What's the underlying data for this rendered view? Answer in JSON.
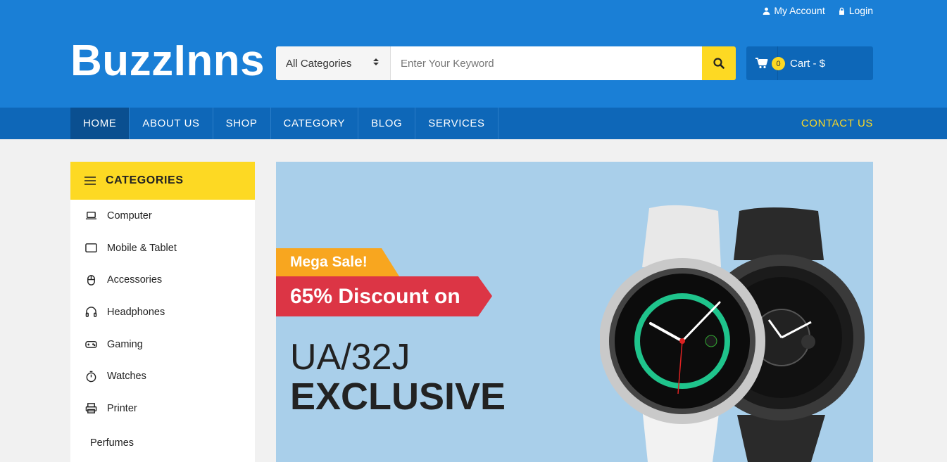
{
  "header": {
    "top_links": {
      "account": "My Account",
      "login": "Login"
    },
    "logo": "BuzzInns",
    "search": {
      "category": "All Categories",
      "placeholder": "Enter Your Keyword"
    },
    "cart": {
      "count": "0",
      "label": "Cart - $"
    }
  },
  "nav": {
    "items": [
      "HOME",
      "ABOUT US",
      "SHOP",
      "CATEGORY",
      "BLOG",
      "SERVICES"
    ],
    "active": "HOME",
    "contact": "CONTACT US"
  },
  "sidebar": {
    "title": "CATEGORIES",
    "items": [
      {
        "label": "Computer",
        "icon": "laptop-icon"
      },
      {
        "label": "Mobile & Tablet",
        "icon": "tablet-icon"
      },
      {
        "label": "Accessories",
        "icon": "mouse-icon"
      },
      {
        "label": "Headphones",
        "icon": "headphones-icon"
      },
      {
        "label": "Gaming",
        "icon": "gamepad-icon"
      },
      {
        "label": "Watches",
        "icon": "stopwatch-icon"
      },
      {
        "label": "Printer",
        "icon": "printer-icon"
      },
      {
        "label": "Perfumes",
        "icon": ""
      }
    ]
  },
  "banner": {
    "tag": "Mega Sale!",
    "discount": "65% Discount on",
    "model": "UA/32J",
    "headline": "EXCLUSIVE"
  },
  "colors": {
    "header_blue": "#1a7fd6",
    "nav_blue": "#0e67b8",
    "accent_yellow": "#fdd923",
    "sale_orange": "#f8a61f",
    "discount_red": "#dc3545",
    "banner_bg": "#a9cfea"
  }
}
